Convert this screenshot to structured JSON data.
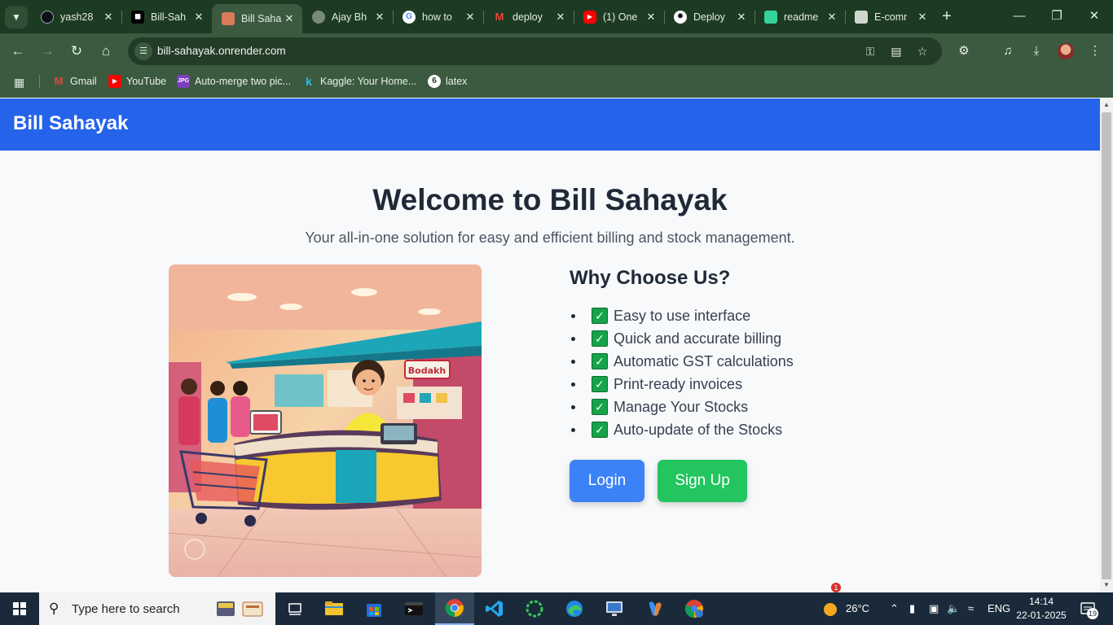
{
  "browser": {
    "tabs": [
      {
        "title": "yash28",
        "icon": "github-icon",
        "color": "#1d3b22"
      },
      {
        "title": "Bill-Sah",
        "icon": "render-icon",
        "color": "#000000"
      },
      {
        "title": "Bill Saha",
        "icon": "bill-sahayak-icon",
        "color": "#d97b5a",
        "active": true
      },
      {
        "title": "Ajay Bh",
        "icon": "globe-icon",
        "color": "#7a8a7a"
      },
      {
        "title": "how to",
        "icon": "google-icon",
        "color": "#ffffff"
      },
      {
        "title": "deploy",
        "icon": "gmail-icon",
        "color": "#ea4335"
      },
      {
        "title": "(1) One",
        "icon": "youtube-icon",
        "color": "#ff0000"
      },
      {
        "title": "Deploy",
        "icon": "chatgpt-icon",
        "color": "#ffffff"
      },
      {
        "title": "readme",
        "icon": "sheet-icon",
        "color": "#34d399"
      },
      {
        "title": "E-comr",
        "icon": "contact-card-icon",
        "color": "#cfd8cf"
      }
    ],
    "url": "bill-sahayak.onrender.com",
    "bookmarks": [
      {
        "label": "Gmail",
        "icon": "gmail-icon",
        "color": "#ea4335"
      },
      {
        "label": "YouTube",
        "icon": "youtube-icon",
        "color": "#ff0000"
      },
      {
        "label": "Auto-merge two pic...",
        "icon": "jpg-icon",
        "color": "#7b3fbf"
      },
      {
        "label": "Kaggle: Your Home...",
        "icon": "kaggle-icon",
        "color": "#20beff"
      },
      {
        "label": "latex",
        "icon": "overleaf-icon",
        "color": "#ffffff"
      }
    ]
  },
  "site": {
    "brand": "Bill Sahayak",
    "hero_title": "Welcome to Bill Sahayak",
    "hero_subtitle": "Your all-in-one solution for easy and efficient billing and stock management.",
    "why_title": "Why Choose Us?",
    "features": [
      "Easy to use interface",
      "Quick and accurate billing",
      "Automatic GST calculations",
      "Print-ready invoices",
      "Manage Your Stocks",
      "Auto-update of the Stocks"
    ],
    "login_label": "Login",
    "signup_label": "Sign Up",
    "colors": {
      "header": "#2563eb",
      "login": "#3b82f6",
      "signup": "#22c55e",
      "check": "#16a34a"
    }
  },
  "taskbar": {
    "search_placeholder": "Type here to search",
    "weather": "26°C",
    "weather_badge": "1",
    "language": "ENG",
    "time": "14:14",
    "date": "22-01-2025",
    "notification_count": "19"
  }
}
